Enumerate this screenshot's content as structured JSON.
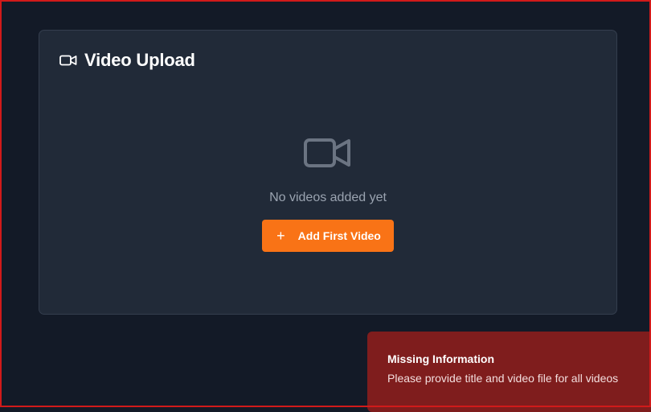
{
  "card": {
    "title": "Video Upload",
    "icon": "video-camera-icon"
  },
  "empty_state": {
    "icon": "video-camera-icon",
    "message": "No videos added yet",
    "button_label": "Add First Video",
    "button_icon": "plus-icon"
  },
  "toast": {
    "title": "Missing Information",
    "message": "Please provide title and video file for all videos"
  },
  "colors": {
    "background": "#131a27",
    "card": "#212a38",
    "accent": "#f97316",
    "toast": "#7f1d1d"
  }
}
